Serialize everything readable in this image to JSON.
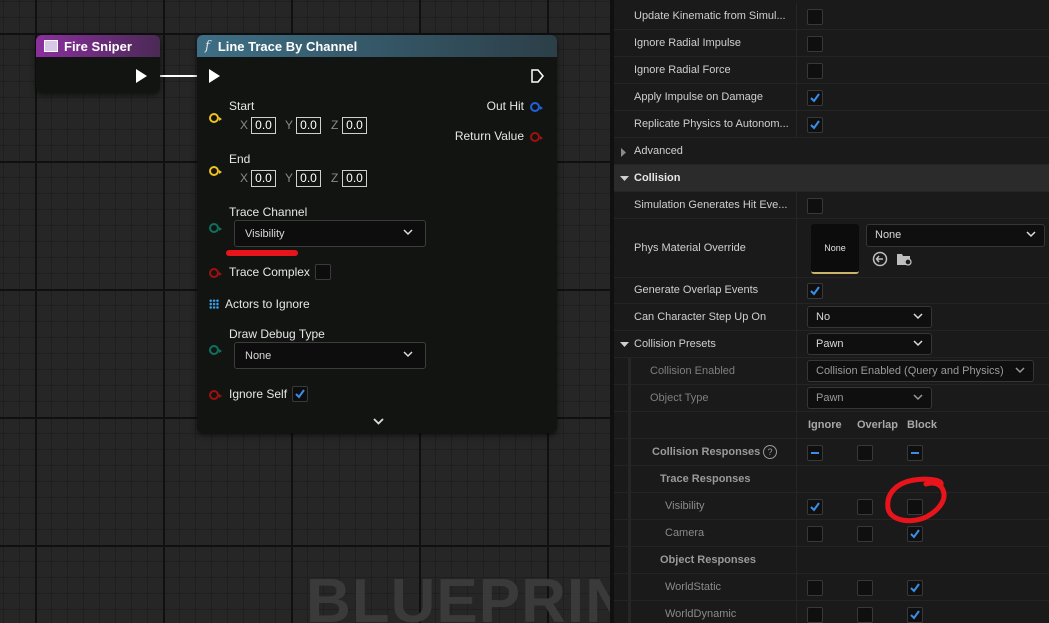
{
  "graph": {
    "watermark": "BLUEPRINT",
    "fire_node": {
      "title": "Fire Sniper"
    },
    "trace_node": {
      "title": "Line Trace By Channel",
      "fx_glyph": "f",
      "start_label": "Start",
      "end_label": "End",
      "axis_x": "X",
      "axis_y": "Y",
      "axis_z": "Z",
      "start_values": [
        "0.0",
        "0.0",
        "0.0"
      ],
      "end_values": [
        "0.0",
        "0.0",
        "0.0"
      ],
      "out_hit_label": "Out Hit",
      "return_value_label": "Return Value",
      "trace_channel_label": "Trace Channel",
      "trace_channel_value": "Visibility",
      "trace_complex_label": "Trace Complex",
      "trace_complex_checked": false,
      "actors_to_ignore_label": "Actors to Ignore",
      "draw_debug_label": "Draw Debug Type",
      "draw_debug_value": "None",
      "ignore_self_label": "Ignore Self",
      "ignore_self_checked": true
    },
    "colors": {
      "fire_header": "#8b2f9e",
      "trace_header": "#3e6f86",
      "vector_pin": "#f0c020",
      "struct_pin": "#2060e0",
      "bool_pin": "#a01010",
      "byte_pin": "#107060",
      "annotation_red": "#e8141c"
    }
  },
  "panel": {
    "rows": {
      "update_kinematic": {
        "label": "Update Kinematic from Simul...",
        "checked": false
      },
      "ignore_radial_impulse": {
        "label": "Ignore Radial Impulse",
        "checked": false
      },
      "ignore_radial_force": {
        "label": "Ignore Radial Force",
        "checked": false
      },
      "apply_impulse": {
        "label": "Apply Impulse on Damage",
        "checked": true
      },
      "replicate_physics": {
        "label": "Replicate Physics to Autonom...",
        "checked": true
      },
      "advanced": {
        "label": "Advanced"
      },
      "collision_section": {
        "label": "Collision"
      },
      "sim_generates_hit": {
        "label": "Simulation Generates Hit Eve...",
        "checked": false
      },
      "phys_material": {
        "label": "Phys Material Override",
        "thumb_label": "None",
        "dropdown_value": "None"
      },
      "generate_overlap": {
        "label": "Generate Overlap Events",
        "checked": true
      },
      "step_up": {
        "label": "Can Character Step Up On",
        "value": "No"
      },
      "collision_presets": {
        "label": "Collision Presets",
        "value": "Pawn"
      },
      "collision_enabled": {
        "label": "Collision Enabled",
        "value": "Collision Enabled (Query and Physics)"
      },
      "object_type": {
        "label": "Object Type",
        "value": "Pawn"
      }
    },
    "response_headers": [
      "Ignore",
      "Overlap",
      "Block"
    ],
    "collision_responses": {
      "label": "Collision Responses",
      "help": "?"
    },
    "trace_responses": {
      "label": "Trace Responses",
      "items": [
        {
          "name": "Visibility",
          "state": "Ignore"
        },
        {
          "name": "Camera",
          "state": "Block"
        }
      ]
    },
    "object_responses": {
      "label": "Object Responses",
      "items": [
        {
          "name": "WorldStatic",
          "state": "Block"
        },
        {
          "name": "WorldDynamic",
          "state": "Block"
        }
      ]
    },
    "colors": {
      "accent_blue": "#3b8ee8",
      "section_bg": "#2b2b2b"
    }
  }
}
